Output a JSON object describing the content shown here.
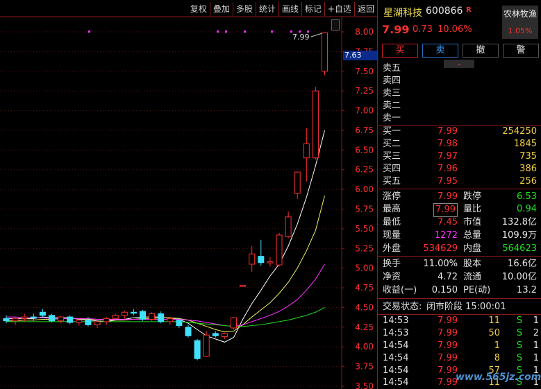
{
  "toolbar": {
    "buttons": [
      "复权",
      "叠加",
      "多股",
      "统计",
      "画线",
      "标记",
      "+自选",
      "返回"
    ]
  },
  "chart": {
    "current_price_flag": "7.63",
    "high_label": "7.99",
    "y_axis_labels": [
      "8.00",
      "7.75",
      "7.50",
      "7.25",
      "7.00",
      "6.75",
      "6.50",
      "6.25",
      "6.00",
      "5.75",
      "5.50",
      "5.25",
      "5.00",
      "4.75",
      "4.50",
      "4.25",
      "4.00",
      "3.75",
      "3.50"
    ]
  },
  "chart_data": {
    "type": "candlestick",
    "ylim": [
      3.5,
      8.0
    ],
    "grid": true,
    "up_color": "#ff3030",
    "down_color": "#40e0ff",
    "candles": [
      {
        "o": 4.36,
        "h": 4.4,
        "l": 4.3,
        "c": 4.33
      },
      {
        "o": 4.33,
        "h": 4.38,
        "l": 4.28,
        "c": 4.36
      },
      {
        "o": 4.36,
        "h": 4.42,
        "l": 4.32,
        "c": 4.38
      },
      {
        "o": 4.38,
        "h": 4.42,
        "l": 4.33,
        "c": 4.37
      },
      {
        "o": 4.44,
        "h": 4.48,
        "l": 4.38,
        "c": 4.4
      },
      {
        "o": 4.4,
        "h": 4.42,
        "l": 4.31,
        "c": 4.33
      },
      {
        "o": 4.33,
        "h": 4.39,
        "l": 4.3,
        "c": 4.38
      },
      {
        "o": 4.38,
        "h": 4.4,
        "l": 4.29,
        "c": 4.31
      },
      {
        "o": 4.31,
        "h": 4.36,
        "l": 4.27,
        "c": 4.34
      },
      {
        "o": 4.34,
        "h": 4.38,
        "l": 4.26,
        "c": 4.28
      },
      {
        "o": 4.28,
        "h": 4.34,
        "l": 4.24,
        "c": 4.32
      },
      {
        "o": 4.32,
        "h": 4.38,
        "l": 4.28,
        "c": 4.36
      },
      {
        "o": 4.36,
        "h": 4.42,
        "l": 4.32,
        "c": 4.4
      },
      {
        "o": 4.4,
        "h": 4.46,
        "l": 4.36,
        "c": 4.44
      },
      {
        "o": 4.44,
        "h": 4.48,
        "l": 4.4,
        "c": 4.43
      },
      {
        "o": 4.45,
        "h": 4.47,
        "l": 4.33,
        "c": 4.35
      },
      {
        "o": 4.35,
        "h": 4.44,
        "l": 4.33,
        "c": 4.42
      },
      {
        "o": 4.42,
        "h": 4.45,
        "l": 4.3,
        "c": 4.32
      },
      {
        "o": 4.32,
        "h": 4.38,
        "l": 4.28,
        "c": 4.36
      },
      {
        "o": 4.34,
        "h": 4.37,
        "l": 4.24,
        "c": 4.27
      },
      {
        "o": 4.25,
        "h": 4.28,
        "l": 4.12,
        "c": 4.14
      },
      {
        "o": 4.08,
        "h": 4.1,
        "l": 3.83,
        "c": 3.85
      },
      {
        "o": 3.88,
        "h": 4.2,
        "l": 3.87,
        "c": 4.15
      },
      {
        "o": 4.17,
        "h": 4.2,
        "l": 4.12,
        "c": 4.14
      },
      {
        "o": 4.13,
        "h": 4.18,
        "l": 4.1,
        "c": 4.17
      },
      {
        "o": 4.24,
        "h": 4.38,
        "l": 4.22,
        "c": 4.37
      },
      {
        "o": 4.78,
        "h": 4.78,
        "l": 4.78,
        "c": 4.78
      },
      {
        "o": 5.05,
        "h": 5.28,
        "l": 4.95,
        "c": 5.18
      },
      {
        "o": 5.15,
        "h": 5.36,
        "l": 5.03,
        "c": 5.07
      },
      {
        "o": 5.08,
        "h": 5.14,
        "l": 5.02,
        "c": 5.08
      },
      {
        "o": 5.04,
        "h": 5.45,
        "l": 5.02,
        "c": 5.42
      },
      {
        "o": 5.4,
        "h": 5.72,
        "l": 5.38,
        "c": 5.65
      },
      {
        "o": 5.95,
        "h": 6.2,
        "l": 5.88,
        "c": 6.22
      },
      {
        "o": 6.4,
        "h": 6.78,
        "l": 6.1,
        "c": 6.58
      },
      {
        "o": 6.4,
        "h": 7.3,
        "l": 6.38,
        "c": 7.25
      },
      {
        "o": 7.5,
        "h": 7.99,
        "l": 7.45,
        "c": 7.99
      }
    ],
    "ma_colors": [
      "#ffffff",
      "#f0f060",
      "#ff30ff",
      "#20e020"
    ],
    "ma_lines": [
      [
        4.36,
        4.36,
        4.36,
        4.36,
        4.38,
        4.37,
        4.37,
        4.37,
        4.35,
        4.34,
        4.33,
        4.32,
        4.34,
        4.35,
        4.37,
        4.38,
        4.38,
        4.38,
        4.36,
        4.35,
        4.3,
        4.22,
        4.14,
        4.1,
        4.06,
        4.12,
        4.35,
        4.55,
        4.72,
        4.9,
        5.05,
        5.28,
        5.56,
        5.9,
        6.3,
        6.75
      ],
      [
        4.33,
        4.33,
        4.34,
        4.34,
        4.35,
        4.35,
        4.36,
        4.36,
        4.36,
        4.35,
        4.35,
        4.34,
        4.34,
        4.34,
        4.35,
        4.36,
        4.36,
        4.37,
        4.37,
        4.36,
        4.34,
        4.3,
        4.26,
        4.22,
        4.19,
        4.2,
        4.28,
        4.38,
        4.47,
        4.56,
        4.68,
        4.82,
        5.0,
        5.22,
        5.48,
        5.92
      ],
      [
        4.38,
        4.38,
        4.37,
        4.37,
        4.37,
        4.36,
        4.36,
        4.36,
        4.36,
        4.36,
        4.35,
        4.35,
        4.35,
        4.35,
        4.35,
        4.35,
        4.35,
        4.35,
        4.35,
        4.35,
        4.34,
        4.33,
        4.31,
        4.29,
        4.27,
        4.26,
        4.28,
        4.32,
        4.36,
        4.4,
        4.45,
        4.52,
        4.6,
        4.72,
        4.86,
        5.05
      ],
      [
        4.32,
        4.32,
        4.32,
        4.32,
        4.32,
        4.32,
        4.32,
        4.32,
        4.32,
        4.32,
        4.32,
        4.32,
        4.32,
        4.32,
        4.32,
        4.32,
        4.32,
        4.32,
        4.32,
        4.32,
        4.31,
        4.3,
        4.29,
        4.28,
        4.27,
        4.26,
        4.26,
        4.27,
        4.28,
        4.3,
        4.32,
        4.34,
        4.37,
        4.4,
        4.44,
        4.5
      ]
    ]
  },
  "quote": {
    "name": "星湖科技",
    "code": "600866",
    "badge": "R",
    "price": "7.99",
    "change": "0.73",
    "pct": "10.06%",
    "sector_name": "农林牧渔",
    "sector_pct": "1.05%"
  },
  "trade_buttons": {
    "buy": "买",
    "sell": "卖",
    "cancel": "撤",
    "alert": "警"
  },
  "collapse_icon": "chevron-down-icon",
  "order_book": {
    "asks": [
      {
        "label": "卖五",
        "price": "",
        "vol": ""
      },
      {
        "label": "卖四",
        "price": "",
        "vol": ""
      },
      {
        "label": "卖三",
        "price": "",
        "vol": ""
      },
      {
        "label": "卖二",
        "price": "",
        "vol": ""
      },
      {
        "label": "卖一",
        "price": "",
        "vol": ""
      }
    ],
    "bids": [
      {
        "label": "买一",
        "price": "7.99",
        "vol": "254250"
      },
      {
        "label": "买二",
        "price": "7.98",
        "vol": "1845"
      },
      {
        "label": "买三",
        "price": "7.97",
        "vol": "735"
      },
      {
        "label": "买四",
        "price": "7.96",
        "vol": "386"
      },
      {
        "label": "买五",
        "price": "7.95",
        "vol": "256"
      }
    ]
  },
  "stats": {
    "limit_up_label": "涨停",
    "limit_up": "7.99",
    "limit_down_label": "跌停",
    "limit_down": "6.53",
    "high_label": "最高",
    "high": "7.99",
    "vol_ratio_label": "量比",
    "vol_ratio": "0.94",
    "low_label": "最低",
    "low": "7.45",
    "mkt_cap_label": "市值",
    "mkt_cap": "132.8亿",
    "cur_vol_label": "现量",
    "cur_vol": "1272",
    "total_vol_label": "总量",
    "total_vol": "109.9万",
    "outer_label": "外盘",
    "outer": "534629",
    "inner_label": "内盘",
    "inner": "564623",
    "turnover_label": "换手",
    "turnover": "11.00%",
    "equity_label": "股本",
    "equity": "16.6亿",
    "nav_label": "净资",
    "nav": "4.72",
    "float_label": "流通",
    "float": "10.00亿",
    "eps_label": "收益(一)",
    "eps": "0.150",
    "pe_label": "PE(动)",
    "pe": "13.2"
  },
  "status": {
    "label": "交易状态:",
    "value": "闭市阶段 15:00:01"
  },
  "ticks": [
    {
      "time": "14:53",
      "price": "7.99",
      "vol": "11",
      "side": "S",
      "cnt": "1"
    },
    {
      "time": "14:53",
      "price": "7.99",
      "vol": "50",
      "side": "S",
      "cnt": "2"
    },
    {
      "time": "14:54",
      "price": "7.99",
      "vol": "1",
      "side": "S",
      "cnt": "1"
    },
    {
      "time": "14:54",
      "price": "7.99",
      "vol": "8",
      "side": "S",
      "cnt": "1"
    },
    {
      "time": "14:54",
      "price": "7.99",
      "vol": "57",
      "side": "S",
      "cnt": "1"
    },
    {
      "time": "14:54",
      "price": "7.99",
      "vol": "11",
      "side": "S",
      "cnt": "1"
    }
  ],
  "watermark": "www.565jz.com"
}
